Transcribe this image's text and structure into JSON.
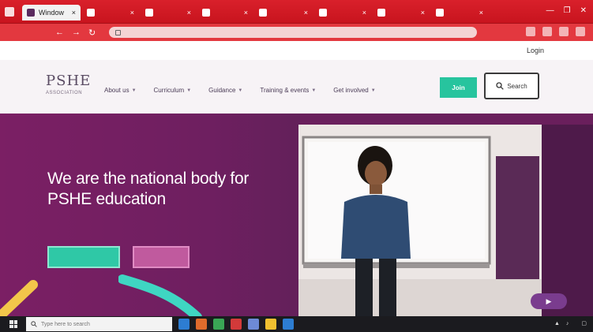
{
  "browser": {
    "tabs": [
      {
        "label": "Window",
        "active": true,
        "favicon_color": "#5a2a5e"
      },
      {
        "label": "",
        "active": false,
        "favicon_color": "#ffffff"
      },
      {
        "label": "",
        "active": false,
        "favicon_color": "#ffffff"
      },
      {
        "label": "",
        "active": false,
        "favicon_color": "#ffffff"
      },
      {
        "label": "",
        "active": false,
        "favicon_color": "#ffffff"
      },
      {
        "label": "",
        "active": false,
        "favicon_color": "#ffffff"
      },
      {
        "label": "",
        "active": false,
        "favicon_color": "#ffffff"
      },
      {
        "label": "",
        "active": false,
        "favicon_color": "#ffffff"
      }
    ],
    "window_controls": [
      "—",
      "❐",
      "✕"
    ],
    "url": "",
    "nav_icons": [
      "back-icon",
      "forward-icon",
      "refresh-icon"
    ]
  },
  "site": {
    "utility_link": "Login",
    "logo_mark": "PSHE",
    "logo_sub": "ASSOCIATION",
    "nav": [
      {
        "label": "About us",
        "has_menu": true
      },
      {
        "label": "Curriculum",
        "has_menu": true
      },
      {
        "label": "Guidance",
        "has_menu": true
      },
      {
        "label": "Training & events",
        "has_menu": true
      },
      {
        "label": "Get involved",
        "has_menu": true
      }
    ],
    "join_label": "Join",
    "search_label": "Search",
    "accent_color": "#27c49e",
    "brand_color": "#6a1f5c"
  },
  "hero": {
    "headline": "We are the national body for PSHE education",
    "lede": "",
    "cta_primary": "",
    "cta_secondary": "",
    "play_label": ""
  },
  "taskbar": {
    "search_placeholder": "Type here to search",
    "tray_time": "",
    "app_icon_colors": [
      "#2d7dd2",
      "#e06b2c",
      "#3aa655",
      "#d33a3a",
      "#6e8ad6",
      "#f0c030",
      "#2d7dd2"
    ]
  }
}
